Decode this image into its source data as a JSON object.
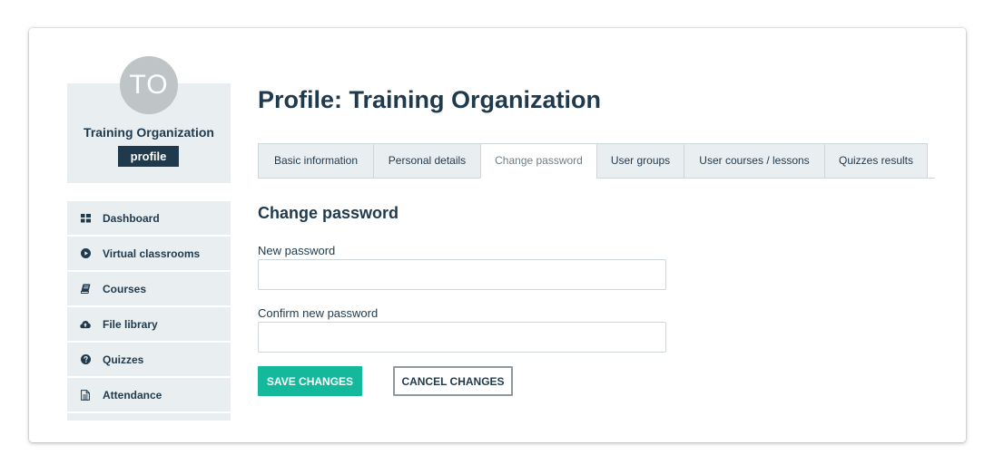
{
  "profile": {
    "avatar_initials": "TO",
    "name": "Training Organization",
    "badge": "profile"
  },
  "sidebar": {
    "items": [
      {
        "label": "Dashboard",
        "icon": "grid-icon"
      },
      {
        "label": "Virtual classrooms",
        "icon": "play-circle-icon"
      },
      {
        "label": "Courses",
        "icon": "book-icon"
      },
      {
        "label": "File library",
        "icon": "cloud-upload-icon"
      },
      {
        "label": "Quizzes",
        "icon": "question-circle-icon"
      },
      {
        "label": "Attendance",
        "icon": "document-icon"
      }
    ]
  },
  "main": {
    "page_title": "Profile: Training Organization",
    "tabs": [
      {
        "label": "Basic information",
        "active": false
      },
      {
        "label": "Personal details",
        "active": false
      },
      {
        "label": "Change password",
        "active": true
      },
      {
        "label": "User groups",
        "active": false
      },
      {
        "label": "User courses / lessons",
        "active": false
      },
      {
        "label": "Quizzes results",
        "active": false
      }
    ],
    "section_title": "Change password",
    "new_password_label": "New password",
    "new_password_value": "",
    "confirm_password_label": "Confirm new password",
    "confirm_password_value": "",
    "save_label": "SAVE CHANGES",
    "cancel_label": "CANCEL CHANGES"
  },
  "colors": {
    "primary_text": "#1f3a4d",
    "sidebar_bg": "#e9eef0",
    "save_button": "#13b99a",
    "avatar_bg": "#bfc4c7"
  }
}
